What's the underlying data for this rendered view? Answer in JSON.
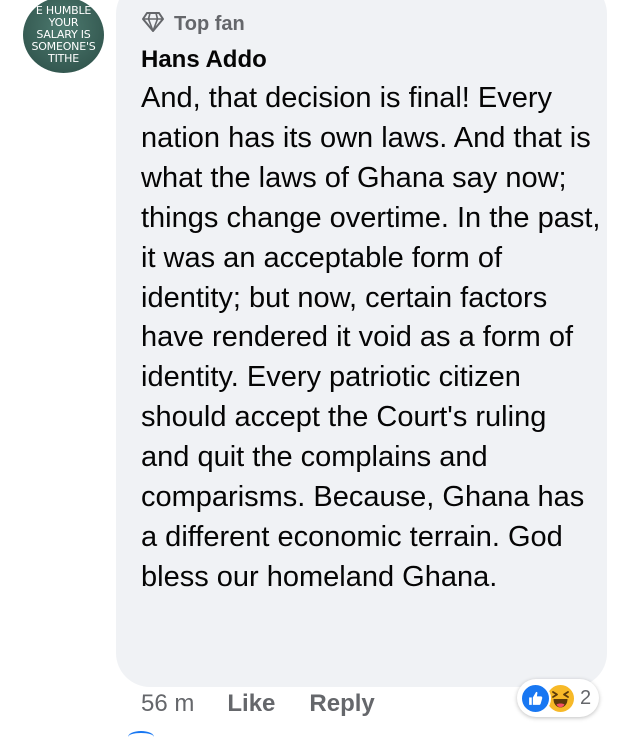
{
  "avatar": {
    "lines": [
      "E HUMBLE",
      "YOUR",
      "SALARY IS",
      "SOMEONE'S",
      "TITHE"
    ]
  },
  "comment": {
    "badge_icon": "diamond-icon",
    "badge_label": "Top fan",
    "author": "Hans Addo",
    "text": "And, that decision is final! Every nation has its own laws. And that is what the laws of Ghana say now; things change overtime. In the past, it was an acceptable form of identity; but now, certain factors have rendered it void as a form of identity. Every patriotic citizen should accept the Court's ruling and quit the complains and comparisms. Because, Ghana has a different economic terrain. God bless our homeland Ghana."
  },
  "actions": {
    "time": "56 m",
    "like_label": "Like",
    "reply_label": "Reply"
  },
  "reactions": {
    "icons": [
      "like-reaction-icon",
      "haha-reaction-icon"
    ],
    "count": "2"
  },
  "colors": {
    "bubble": "#f0f2f5",
    "secondary_text": "#65676b",
    "primary_text": "#050505",
    "like_blue": "#1877f2",
    "haha_yellow": "#f7b928"
  }
}
